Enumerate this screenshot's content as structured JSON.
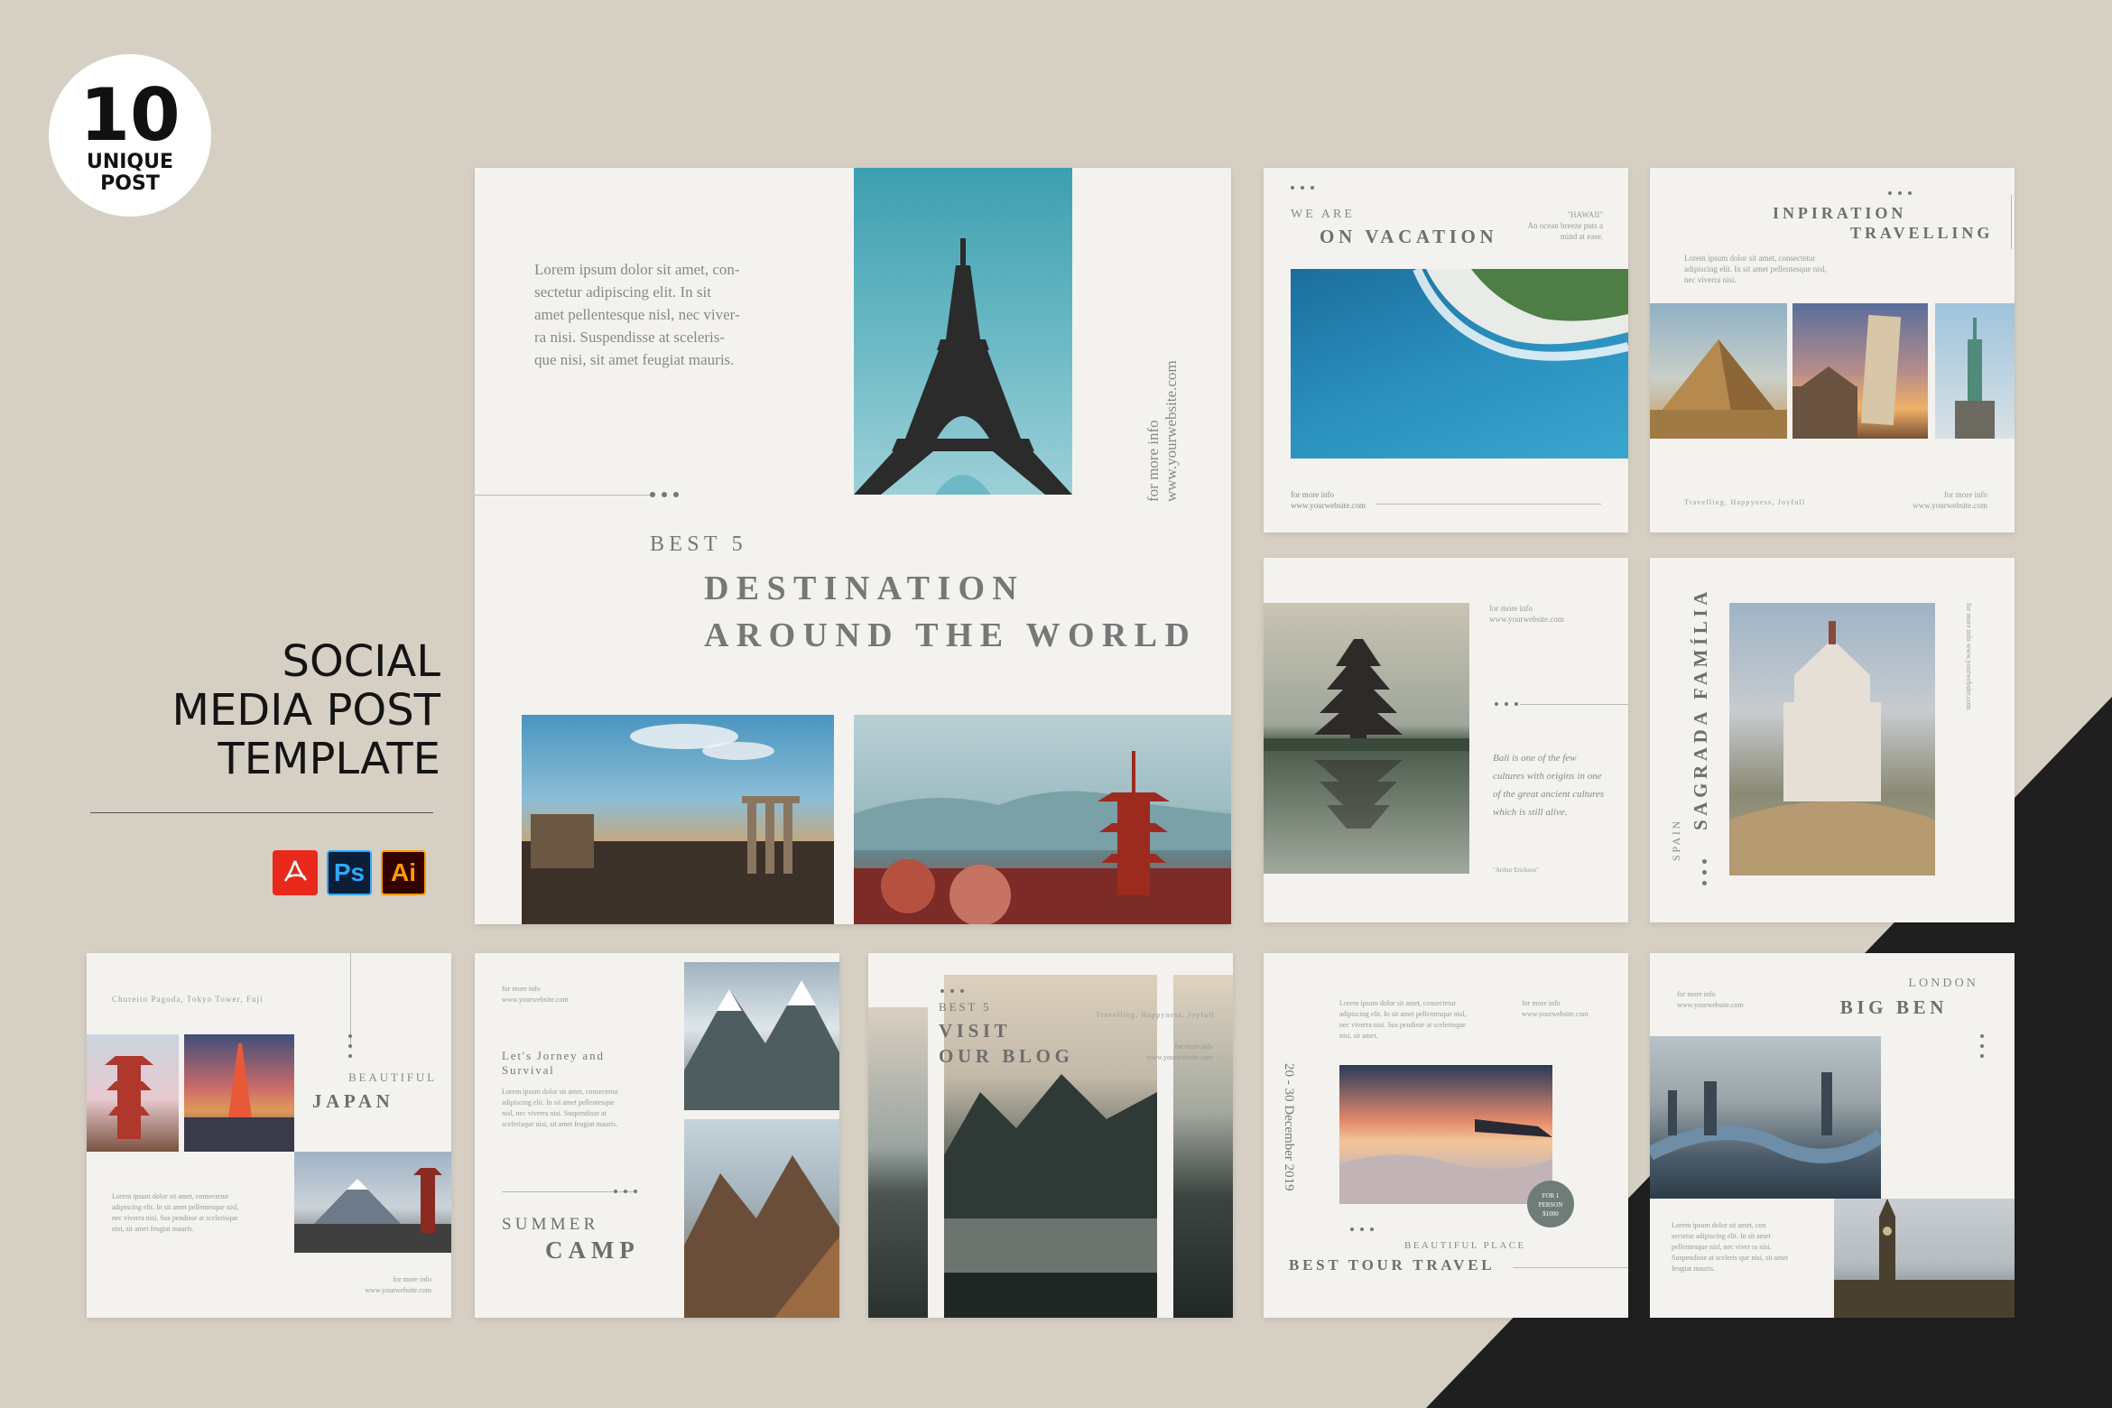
{
  "badge": {
    "number": "10",
    "line1": "UNIQUE",
    "line2": "POST"
  },
  "title": {
    "line1": "SOCIAL",
    "line2": "MEDIA POST",
    "line3": "TEMPLATE"
  },
  "software": [
    {
      "name": "pdf-icon",
      "label": "PDF",
      "bg": "#e8291c"
    },
    {
      "name": "photoshop-icon",
      "label": "Ps",
      "bg": "#0a1e37",
      "fg": "#31a8ff"
    },
    {
      "name": "illustrator-icon",
      "label": "Ai",
      "bg": "#330000",
      "fg": "#ff9a00"
    }
  ],
  "colors": {
    "background": "#d6cfc3",
    "card": "#f3f2ef",
    "dark_corner": "#1f1f1f",
    "text": "#6d6d6d"
  },
  "main": {
    "body": "Lorem ipsum dolor sit amet, con-\nsectetur adipiscing elit. In sit\namet pellentesque nisl, nec viver-\nra nisi. Suspendisse at sceleris-\nque nisi, sit amet feugiat mauris.",
    "vertical1": "for more info",
    "vertical2": "www.yourwebsite.com",
    "kicker": "BEST 5",
    "headline1": "DESTINATION",
    "headline2": "AROUND THE WORLD"
  },
  "vacation": {
    "kicker": "WE ARE",
    "headline": "ON VACATION",
    "side1": "\"HAWAII\"",
    "side2": "An ocean breeze puts a",
    "side3": "mind at ease.",
    "info1": "for more info",
    "info2": "www.yourwebsite.com"
  },
  "inspiration": {
    "headline1": "INPIRATION",
    "headline2": "TRAVELLING",
    "body": "Lorem ipsum dolor sit amet, consectetur adipiscing elit. In sit amet pellentesque nisl, nec viverra nisi.",
    "tagline": "Travelling, Happyness, Joyfull",
    "info1": "for more info",
    "info2": "www.yourwebsite.com"
  },
  "bali": {
    "info1": "for more info",
    "info2": "www.yourwebsite.com",
    "quote": "Bali is one of the few cultures with origins in one of the great ancient cultures which is still alive.",
    "author": "\"Arthur Erickson\""
  },
  "sagrada": {
    "headline": "SAGRADA FAMÍLIA",
    "kicker": "SPAIN",
    "info": "for more info www.yourwebsite.com"
  },
  "japan": {
    "tagline": "Chureito Pagoda, Tokyo Tower, Fuji",
    "kicker": "BEAUTIFUL",
    "headline": "JAPAN",
    "body": "Lorem ipsum dolor sit amet, consectetur adipiscing elit. In sit amet pellentesque nisl, nec viverra nisi. Sus pendisse at scelerisque nisi, sit amet feugiat mauris.",
    "info1": "for more info",
    "info2": "www.yourwebsite.com"
  },
  "camp": {
    "info1": "for more info",
    "info2": "www.yourwebsite.com",
    "subtitle": "Let's Jorney and Survival",
    "body": "Lorem ipsum dolor sit amet, consectetur adipiscing elit. In sit amet pellentesque nisl, nec viverra nisi. Suspendisse at scelerisque nisi, sit amet feugiat mauris.",
    "kicker": "SUMMER",
    "headline": "CAMP"
  },
  "blog": {
    "kicker": "BEST 5",
    "headline1": "VISIT",
    "headline2": "OUR BLOG",
    "tagline": "Travelling, Happyness, Joyfull",
    "info1": "for more info",
    "info2": "www.yourwebsite.com"
  },
  "tour": {
    "body": "Lorem ipsum dolor sit amet, consectetur adipiscing elit. In sit amet pellentesque nisl, nec viverra nisi. Sus pendisse at scelerisque nisi, sit amet.",
    "info1": "for more info",
    "info2": "www.yourwebsite.com",
    "date": "20 - 30 December 2019",
    "price1": "FOR 1",
    "price2": "PERSON",
    "price3": "$1000",
    "kicker": "BEAUTIFUL PLACE",
    "headline": "BEST TOUR TRAVEL"
  },
  "bigben": {
    "info1": "for more info",
    "info2": "www.yourwebsite.com",
    "kicker": "LONDON",
    "headline": "BIG BEN",
    "body": "Lorem ipsum dolor sit amet, con sectetur adipiscing elit. In sit amet pellentesque nisl, nec viver ra nisi. Suspendisse at sceleris que nisi, sit amet feugiat mauris."
  }
}
